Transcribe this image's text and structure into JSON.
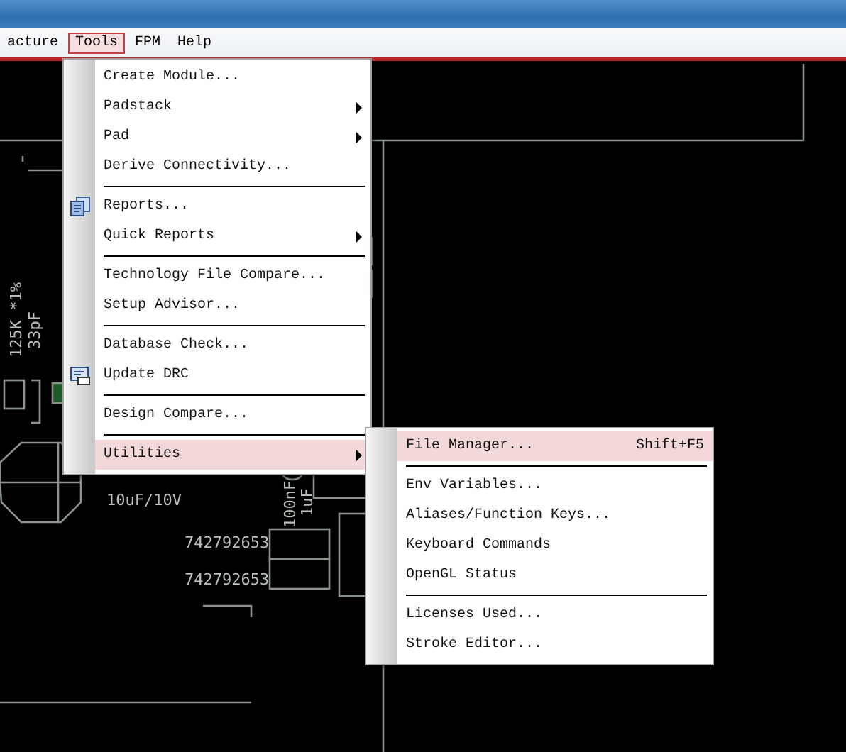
{
  "menu_bar": [
    {
      "label": "acture",
      "selected": false
    },
    {
      "label": "Tools",
      "selected": true
    },
    {
      "label": "FPM",
      "selected": false
    },
    {
      "label": "Help",
      "selected": false
    }
  ],
  "canvas_labels": [
    {
      "text": "125K *1%",
      "kind": "vertical"
    },
    {
      "text": "33pF",
      "kind": "vertical"
    },
    {
      "text": "10uF/10V",
      "kind": "horizontal"
    },
    {
      "text": "100nF",
      "kind": "vertical"
    },
    {
      "text": "1uF",
      "kind": "vertical"
    },
    {
      "text": "742792653",
      "kind": "horizontal"
    },
    {
      "text": "742792653",
      "kind": "horizontal"
    }
  ],
  "tools_menu": [
    {
      "kind": "item",
      "label": "Create Module...",
      "submenu": false,
      "selected": false
    },
    {
      "kind": "item",
      "label": "Padstack",
      "submenu": true,
      "selected": false
    },
    {
      "kind": "item",
      "label": "Pad",
      "submenu": true,
      "selected": false
    },
    {
      "kind": "item",
      "label": "Derive Connectivity...",
      "submenu": false,
      "selected": false
    },
    {
      "kind": "separator"
    },
    {
      "kind": "report-item",
      "label": "Reports...",
      "submenu": false,
      "selected": false
    },
    {
      "kind": "item",
      "label": "Quick Reports",
      "submenu": true,
      "selected": false
    },
    {
      "kind": "separator"
    },
    {
      "kind": "item",
      "label": "Technology File Compare...",
      "submenu": false,
      "selected": false
    },
    {
      "kind": "item",
      "label": "Setup Advisor...",
      "submenu": false,
      "selected": false
    },
    {
      "kind": "separator"
    },
    {
      "kind": "item",
      "label": "Database Check...",
      "submenu": false,
      "selected": false
    },
    {
      "kind": "drc-item",
      "label": "Update DRC",
      "submenu": false,
      "selected": false
    },
    {
      "kind": "separator"
    },
    {
      "kind": "item",
      "label": "Design Compare...",
      "submenu": false,
      "selected": false
    },
    {
      "kind": "separator"
    },
    {
      "kind": "item",
      "label": "Utilities",
      "submenu": true,
      "selected": true
    }
  ],
  "utilities_submenu": [
    {
      "kind": "item",
      "label": "File Manager...",
      "shortcut": "Shift+F5",
      "submenu": false,
      "selected": true
    },
    {
      "kind": "separator"
    },
    {
      "kind": "item",
      "label": "Env Variables...",
      "submenu": false,
      "selected": false
    },
    {
      "kind": "item",
      "label": "Aliases/Function Keys...",
      "submenu": false,
      "selected": false
    },
    {
      "kind": "item",
      "label": "Keyboard Commands",
      "submenu": false,
      "selected": false
    },
    {
      "kind": "item",
      "label": "OpenGL Status",
      "submenu": false,
      "selected": false
    },
    {
      "kind": "separator"
    },
    {
      "kind": "item",
      "label": "Licenses Used...",
      "submenu": false,
      "selected": false
    },
    {
      "kind": "item",
      "label": "Stroke Editor...",
      "submenu": false,
      "selected": false
    }
  ]
}
